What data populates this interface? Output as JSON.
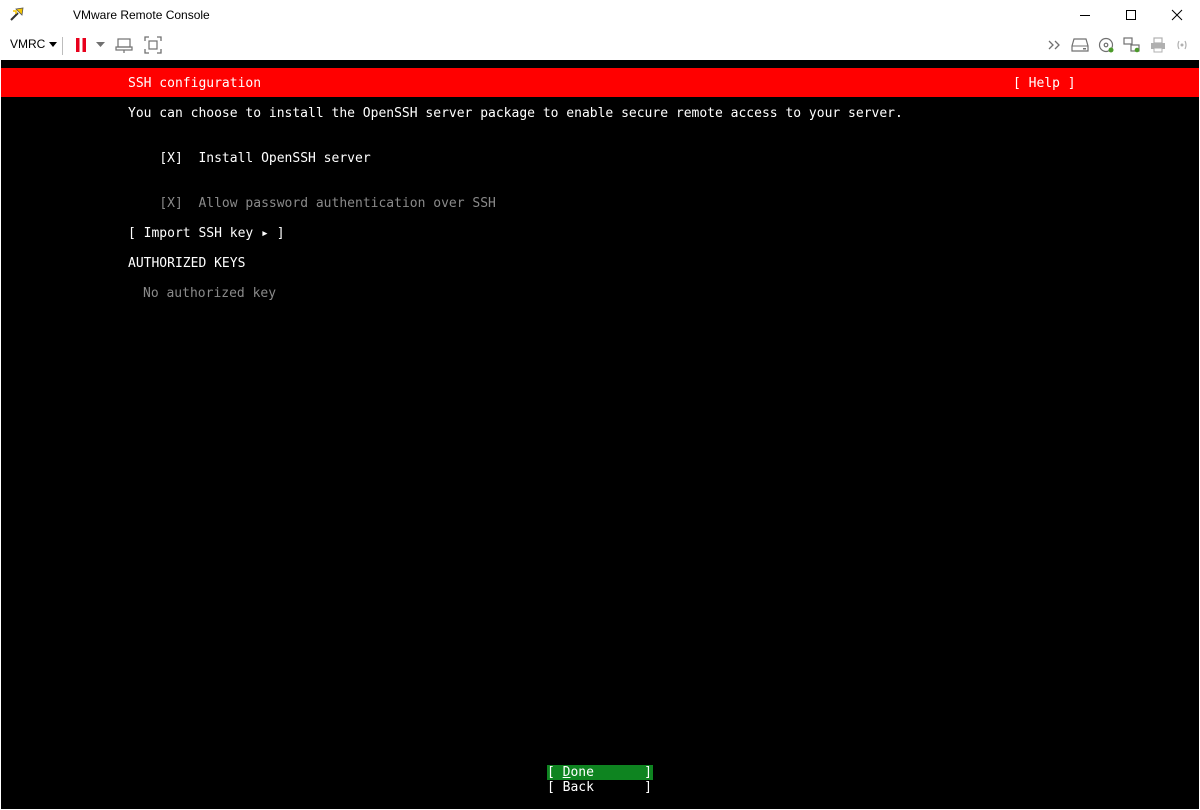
{
  "window": {
    "title": "VMware Remote Console"
  },
  "toolbar": {
    "menu_label": "VMRC"
  },
  "installer": {
    "header_title": "SSH configuration",
    "help": "[ Help ]",
    "description": "You can choose to install the OpenSSH server package to enable secure remote access to your server.",
    "install_openssh": {
      "mark": "[X]",
      "label": "Install OpenSSH server"
    },
    "allow_password": {
      "mark": "[X]",
      "label": "Allow password authentication over SSH"
    },
    "import_key": "[ Import SSH key ▸ ]",
    "authorized_keys_heading": "AUTHORIZED KEYS",
    "no_key": "No authorized key",
    "done": {
      "open": "[ ",
      "hotkey": "D",
      "rest": "one",
      "close": "]"
    },
    "back": {
      "open": "[ ",
      "label": "Back",
      "close": "]"
    }
  },
  "colors": {
    "header_red": "#ff0000",
    "done_green": "#0e8420",
    "console_bg": "#000000",
    "dim_text": "#8a8a8a",
    "pause_red": "#e8001c"
  },
  "icons": [
    "vmrc-logo-icon",
    "minimize-icon",
    "maximize-icon",
    "close-icon",
    "pause-icon",
    "chevron-down-icon",
    "send-ctrl-alt-del-icon",
    "fullscreen-icon",
    "more-icon",
    "hard-disk-icon",
    "cd-dvd-icon",
    "network-adapter-icon",
    "printer-icon",
    "sound-icon"
  ]
}
